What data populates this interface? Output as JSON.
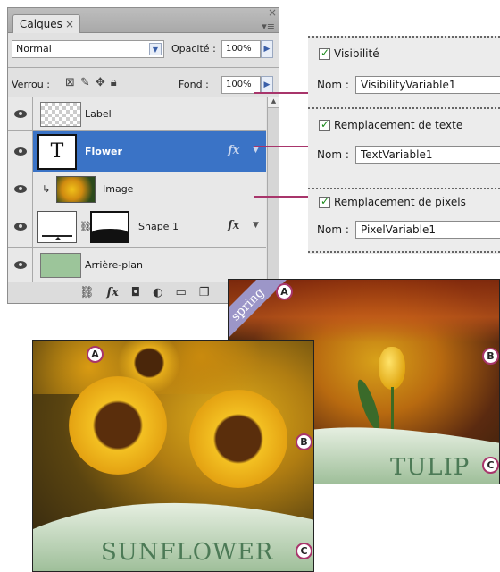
{
  "layers_panel": {
    "tab_label": "Calques",
    "blend_mode": "Normal",
    "opacity_label": "Opacité :",
    "opacity_value": "100%",
    "lock_label": "Verrou :",
    "fill_label": "Fond :",
    "fill_value": "100%",
    "layers": [
      {
        "name": "Label",
        "thumb": "transparent",
        "fx": false,
        "selected": false
      },
      {
        "name": "Flower",
        "thumb": "text",
        "fx": true,
        "selected": true
      },
      {
        "name": "Image",
        "thumb": "photo",
        "fx": false,
        "selected": false,
        "clipped": true
      },
      {
        "name": "Shape 1",
        "thumb": "shape",
        "fx": true,
        "selected": false
      },
      {
        "name": "Arrière-plan",
        "thumb": "green",
        "fx": false,
        "selected": false
      }
    ],
    "text_thumb_glyph": "T",
    "fx_label": "fx",
    "footer_icons": [
      "link-icon",
      "fx-icon",
      "mask-icon",
      "adjustment-icon",
      "folder-icon",
      "new-layer-icon"
    ]
  },
  "variables_dialog": {
    "sections": [
      {
        "checkbox_label": "Visibilité",
        "name_label": "Nom :",
        "name_value": "VisibilityVariable1"
      },
      {
        "checkbox_label": "Remplacement de texte",
        "name_label": "Nom :",
        "name_value": "TextVariable1"
      },
      {
        "checkbox_label": "Remplacement de pixels",
        "name_label": "Nom :",
        "name_value": "PixelVariable1"
      }
    ]
  },
  "photos": {
    "tulip": {
      "label": "TULIP",
      "banner": "spring",
      "markers": [
        "A",
        "B",
        "C"
      ]
    },
    "sunflower": {
      "label": "SUNFLOWER",
      "markers": [
        "A",
        "B",
        "C"
      ]
    }
  },
  "colors": {
    "selection": "#3a73c6",
    "connector": "#a8356b",
    "text_green": "#4c7a56"
  }
}
